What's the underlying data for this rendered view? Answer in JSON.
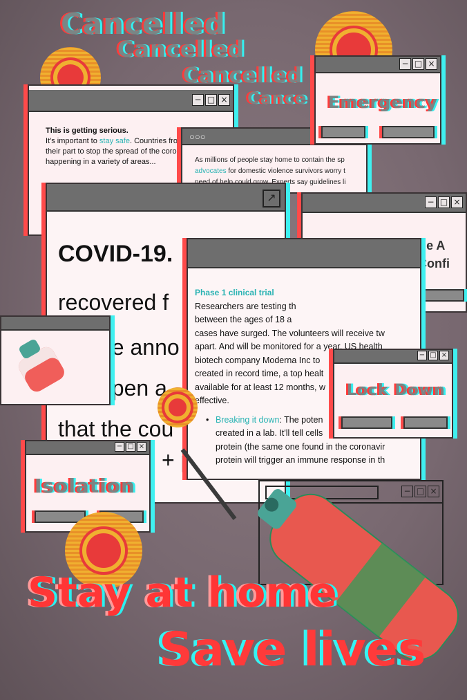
{
  "cancelled_words": [
    "Cancelled",
    "Cancelled",
    "Cancelled",
    "Cance"
  ],
  "window_safe": {
    "heading": "This is getting serious.",
    "text_1": "It's important to ",
    "link": "stay safe",
    "text_2": ". Countries from",
    "line_2": "their part to stop the spread of the coron",
    "line_3": "happening in a variety of areas..."
  },
  "window_violence": {
    "line_1": "As millions of people stay home to contain the sp",
    "link": "advocates",
    "line_2_rest": " for domestic violence survivors worry t",
    "line_3": "need of help could grow. Experts say guidelines li"
  },
  "window_emergency": {
    "title": "Emergency"
  },
  "window_covid19": {
    "headline": "COVID-19.",
    "line_1": "recovered f",
    "line_2": "be anno",
    "line_3": "open a",
    "line_4": "that the cou",
    "line_5": "+ p"
  },
  "window_vaccine": {
    "line_1": "COVID-19 Vaccine A",
    "line_2": "Booking Confi"
  },
  "window_trial": {
    "heading": "Phase 1 clinical trial",
    "lines": [
      "Researchers are testing th",
      "between the ages of 18 a",
      "cases have surged. The volunteers will receive tw",
      "apart. And will be monitored for a year. US health",
      "biotech company Moderna Inc to",
      "created in record time, a top healt",
      "available for at least 12 months, w",
      "effective."
    ],
    "bullet_link": "Breaking it down",
    "bullet_rest": ": The poten",
    "bullet_lines": [
      "created in a lab. It'll tell cells",
      "protein (the same one found in the coronavir",
      "protein will trigger an immune response in th"
    ]
  },
  "window_lockdown": {
    "title": "Lock Down"
  },
  "window_isolation": {
    "title": "Isolation"
  },
  "slogan": {
    "line_1": "Stay at home",
    "line_2": "Save lives"
  },
  "window_controls": {
    "minimize": "−",
    "maximize": "□",
    "close": "×"
  },
  "colors": {
    "red": "#ff3636",
    "cyan": "#35f0f0",
    "yellow": "#f0b030",
    "background": "#786870"
  }
}
